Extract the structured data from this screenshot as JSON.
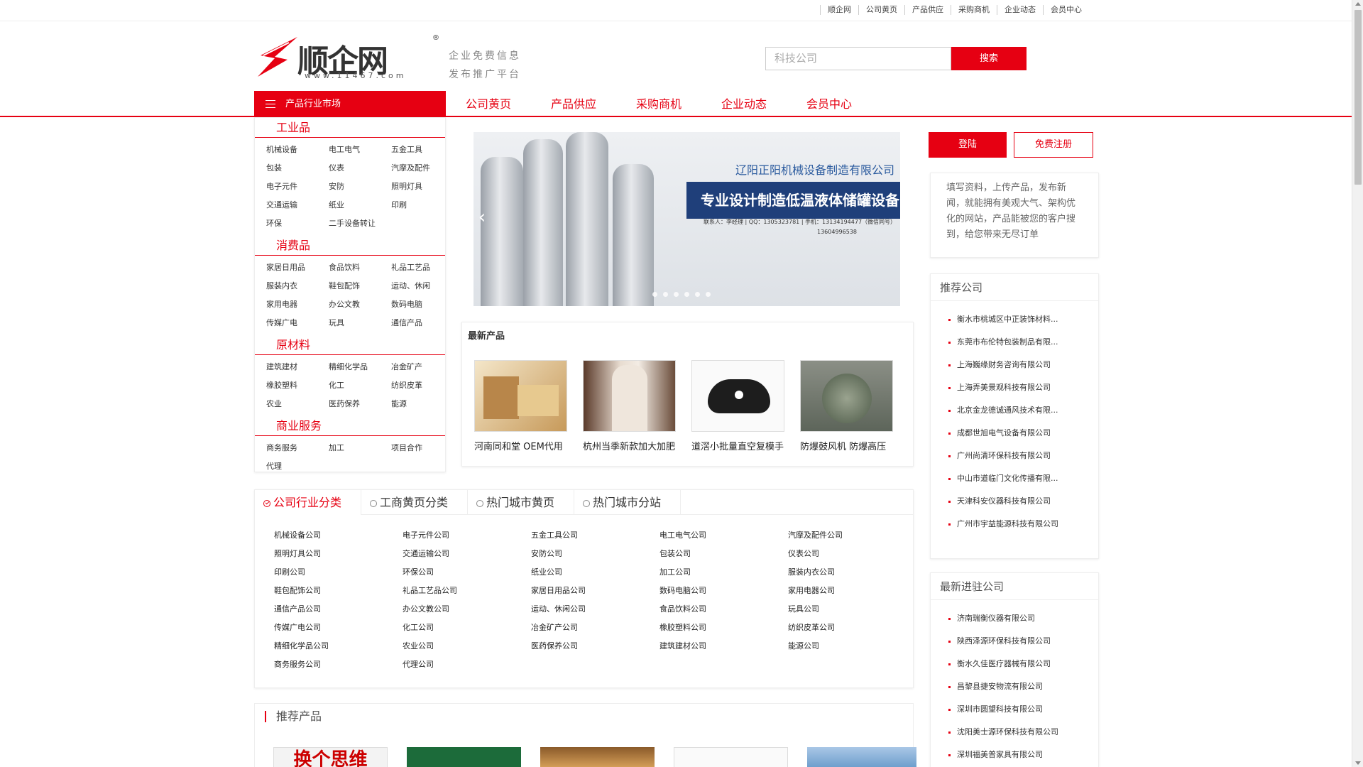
{
  "topbar": {
    "links": [
      "顺企网",
      "公司黄页",
      "产品供应",
      "采购商机",
      "企业动态",
      "会员中心"
    ]
  },
  "header": {
    "logo_text": "顺企网",
    "logo_url": "www.11467.com",
    "logo_reg": "®",
    "slogan_line1": "企业免费信息",
    "slogan_line2": "发布推广平台",
    "search_placeholder": "科技公司",
    "search_button": "搜索"
  },
  "nav": {
    "category_button": "产品行业市场",
    "items": [
      "公司黄页",
      "产品供应",
      "采购商机",
      "企业动态",
      "会员中心"
    ]
  },
  "categories": [
    {
      "title": "工业品",
      "items": [
        "机械设备",
        "电工电气",
        "五金工具",
        "包装",
        "仪表",
        "汽摩及配件",
        "电子元件",
        "安防",
        "照明灯具",
        "交通运输",
        "纸业",
        "印刷",
        "环保",
        "二手设备转让"
      ]
    },
    {
      "title": "消费品",
      "items": [
        "家居日用品",
        "食品饮料",
        "礼品工艺品",
        "服装内衣",
        "鞋包配饰",
        "运动、休闲",
        "家用电器",
        "办公文教",
        "数码电脑",
        "传媒广电",
        "玩具",
        "通信产品"
      ]
    },
    {
      "title": "原材料",
      "items": [
        "建筑建材",
        "精细化学品",
        "冶金矿产",
        "橡胶塑料",
        "化工",
        "纺织皮革",
        "农业",
        "医药保养",
        "能源"
      ]
    },
    {
      "title": "商业服务",
      "items": [
        "商务服务",
        "加工",
        "项目合作",
        "代理"
      ]
    }
  ],
  "banner": {
    "company": "辽阳正阳机械设备制造有限公司",
    "slogan": "专业设计制造低温液体储罐设备",
    "contact_line1": "联系人：李经理 | QQ：1305323781 | 手机：13134194477（微信同号）",
    "contact_line2": "13604996538"
  },
  "latest": {
    "title": "最新产品",
    "items": [
      {
        "name": "河南同和堂 OEM代用"
      },
      {
        "name": "杭州当季新款加大加肥"
      },
      {
        "name": "道滘小批量直空复模手"
      },
      {
        "name": "防爆鼓风机 防爆高压"
      }
    ]
  },
  "auth": {
    "login": "登陆",
    "register": "免费注册"
  },
  "intro": "填写资料，上传产品，发布新闻，就能拥有美观大气、架构优化的网站，产品能被您的客户搜到，给您带来无尽订单",
  "recommended_companies": {
    "title": "推荐公司",
    "items": [
      "衡水市桃城区中正装饰材料...",
      "东莞市布伦特包装制品有限...",
      "上海巍缘财务咨询有限公司",
      "上海弄美景观科技有限公司",
      "北京金龙德诚通风技术有限...",
      "成都世旭电气设备有限公司",
      "广州尚清环保科技有限公司",
      "中山市道临门文化传播有限...",
      "天津科安仪器科技有限公司",
      "广州市宇益能源科技有限公司"
    ]
  },
  "new_companies": {
    "title": "最新进驻公司",
    "items": [
      "济南瑞衡仪器有限公司",
      "陕西泽源环保科技有限公司",
      "衡水久佳医疗器械有限公司",
      "昌黎县捷安物流有限公司",
      "深圳市圆望科技有限公司",
      "沈阳美士源环保科技有限公司",
      "深圳福美普家具有限公司"
    ]
  },
  "company_tabs": {
    "tabs": [
      "公司行业分类",
      "工商黄页分类",
      "热门城市黄页",
      "热门城市分站"
    ],
    "items": [
      "机械设备公司",
      "电子元件公司",
      "五金工具公司",
      "电工电气公司",
      "汽摩及配件公司",
      "照明灯具公司",
      "交通运输公司",
      "安防公司",
      "包装公司",
      "仪表公司",
      "印刷公司",
      "环保公司",
      "纸业公司",
      "加工公司",
      "服装内衣公司",
      "鞋包配饰公司",
      "礼品工艺品公司",
      "家居日用品公司",
      "数码电脑公司",
      "家用电器公司",
      "通信产品公司",
      "办公文教公司",
      "运动、休闲公司",
      "食品饮料公司",
      "玩具公司",
      "传媒广电公司",
      "化工公司",
      "冶金矿产公司",
      "橡胶塑料公司",
      "纺织皮革公司",
      "精细化学品公司",
      "农业公司",
      "医药保养公司",
      "建筑建材公司",
      "能源公司",
      "商务服务公司",
      "代理公司"
    ]
  },
  "recommended_products": {
    "title": "推荐产品",
    "first_thumb_text": "换个思维"
  },
  "colors": {
    "accent": "#e60012"
  }
}
